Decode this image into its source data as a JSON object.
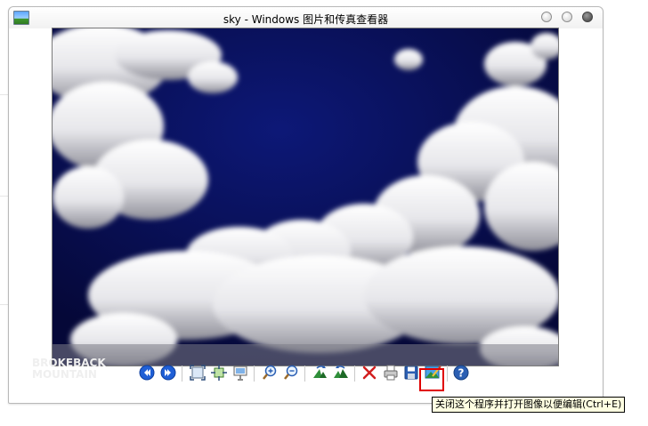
{
  "window": {
    "title": "sky - Windows 图片和传真查看器"
  },
  "watermark": {
    "line1": "BROKEBACK",
    "line2": "MOUNTAIN"
  },
  "toolbar": {
    "buttons": [
      {
        "name": "previous-image-button",
        "icon": "previous-icon"
      },
      {
        "name": "next-image-button",
        "icon": "next-icon"
      },
      {
        "name": "best-fit-button",
        "icon": "best-fit-icon"
      },
      {
        "name": "actual-size-button",
        "icon": "actual-size-icon"
      },
      {
        "name": "slideshow-button",
        "icon": "slideshow-icon"
      },
      {
        "name": "zoom-in-button",
        "icon": "zoom-in-icon"
      },
      {
        "name": "zoom-out-button",
        "icon": "zoom-out-icon"
      },
      {
        "name": "rotate-clockwise-button",
        "icon": "rotate-clockwise-icon"
      },
      {
        "name": "rotate-counterclockwise-button",
        "icon": "rotate-counterclockwise-icon"
      },
      {
        "name": "delete-button",
        "icon": "delete-icon"
      },
      {
        "name": "print-button",
        "icon": "print-icon"
      },
      {
        "name": "save-button",
        "icon": "save-icon"
      },
      {
        "name": "edit-image-button",
        "icon": "edit-image-icon"
      },
      {
        "name": "help-button",
        "icon": "help-icon"
      }
    ]
  },
  "tooltip": {
    "text": "关闭这个程序并打开图像以便编辑(Ctrl+E)"
  },
  "colors": {
    "sky": "#0a0f4a",
    "nav_blue": "#1f5fd6",
    "highlight_red": "#e00000",
    "tooltip_bg": "#ffffe1"
  }
}
